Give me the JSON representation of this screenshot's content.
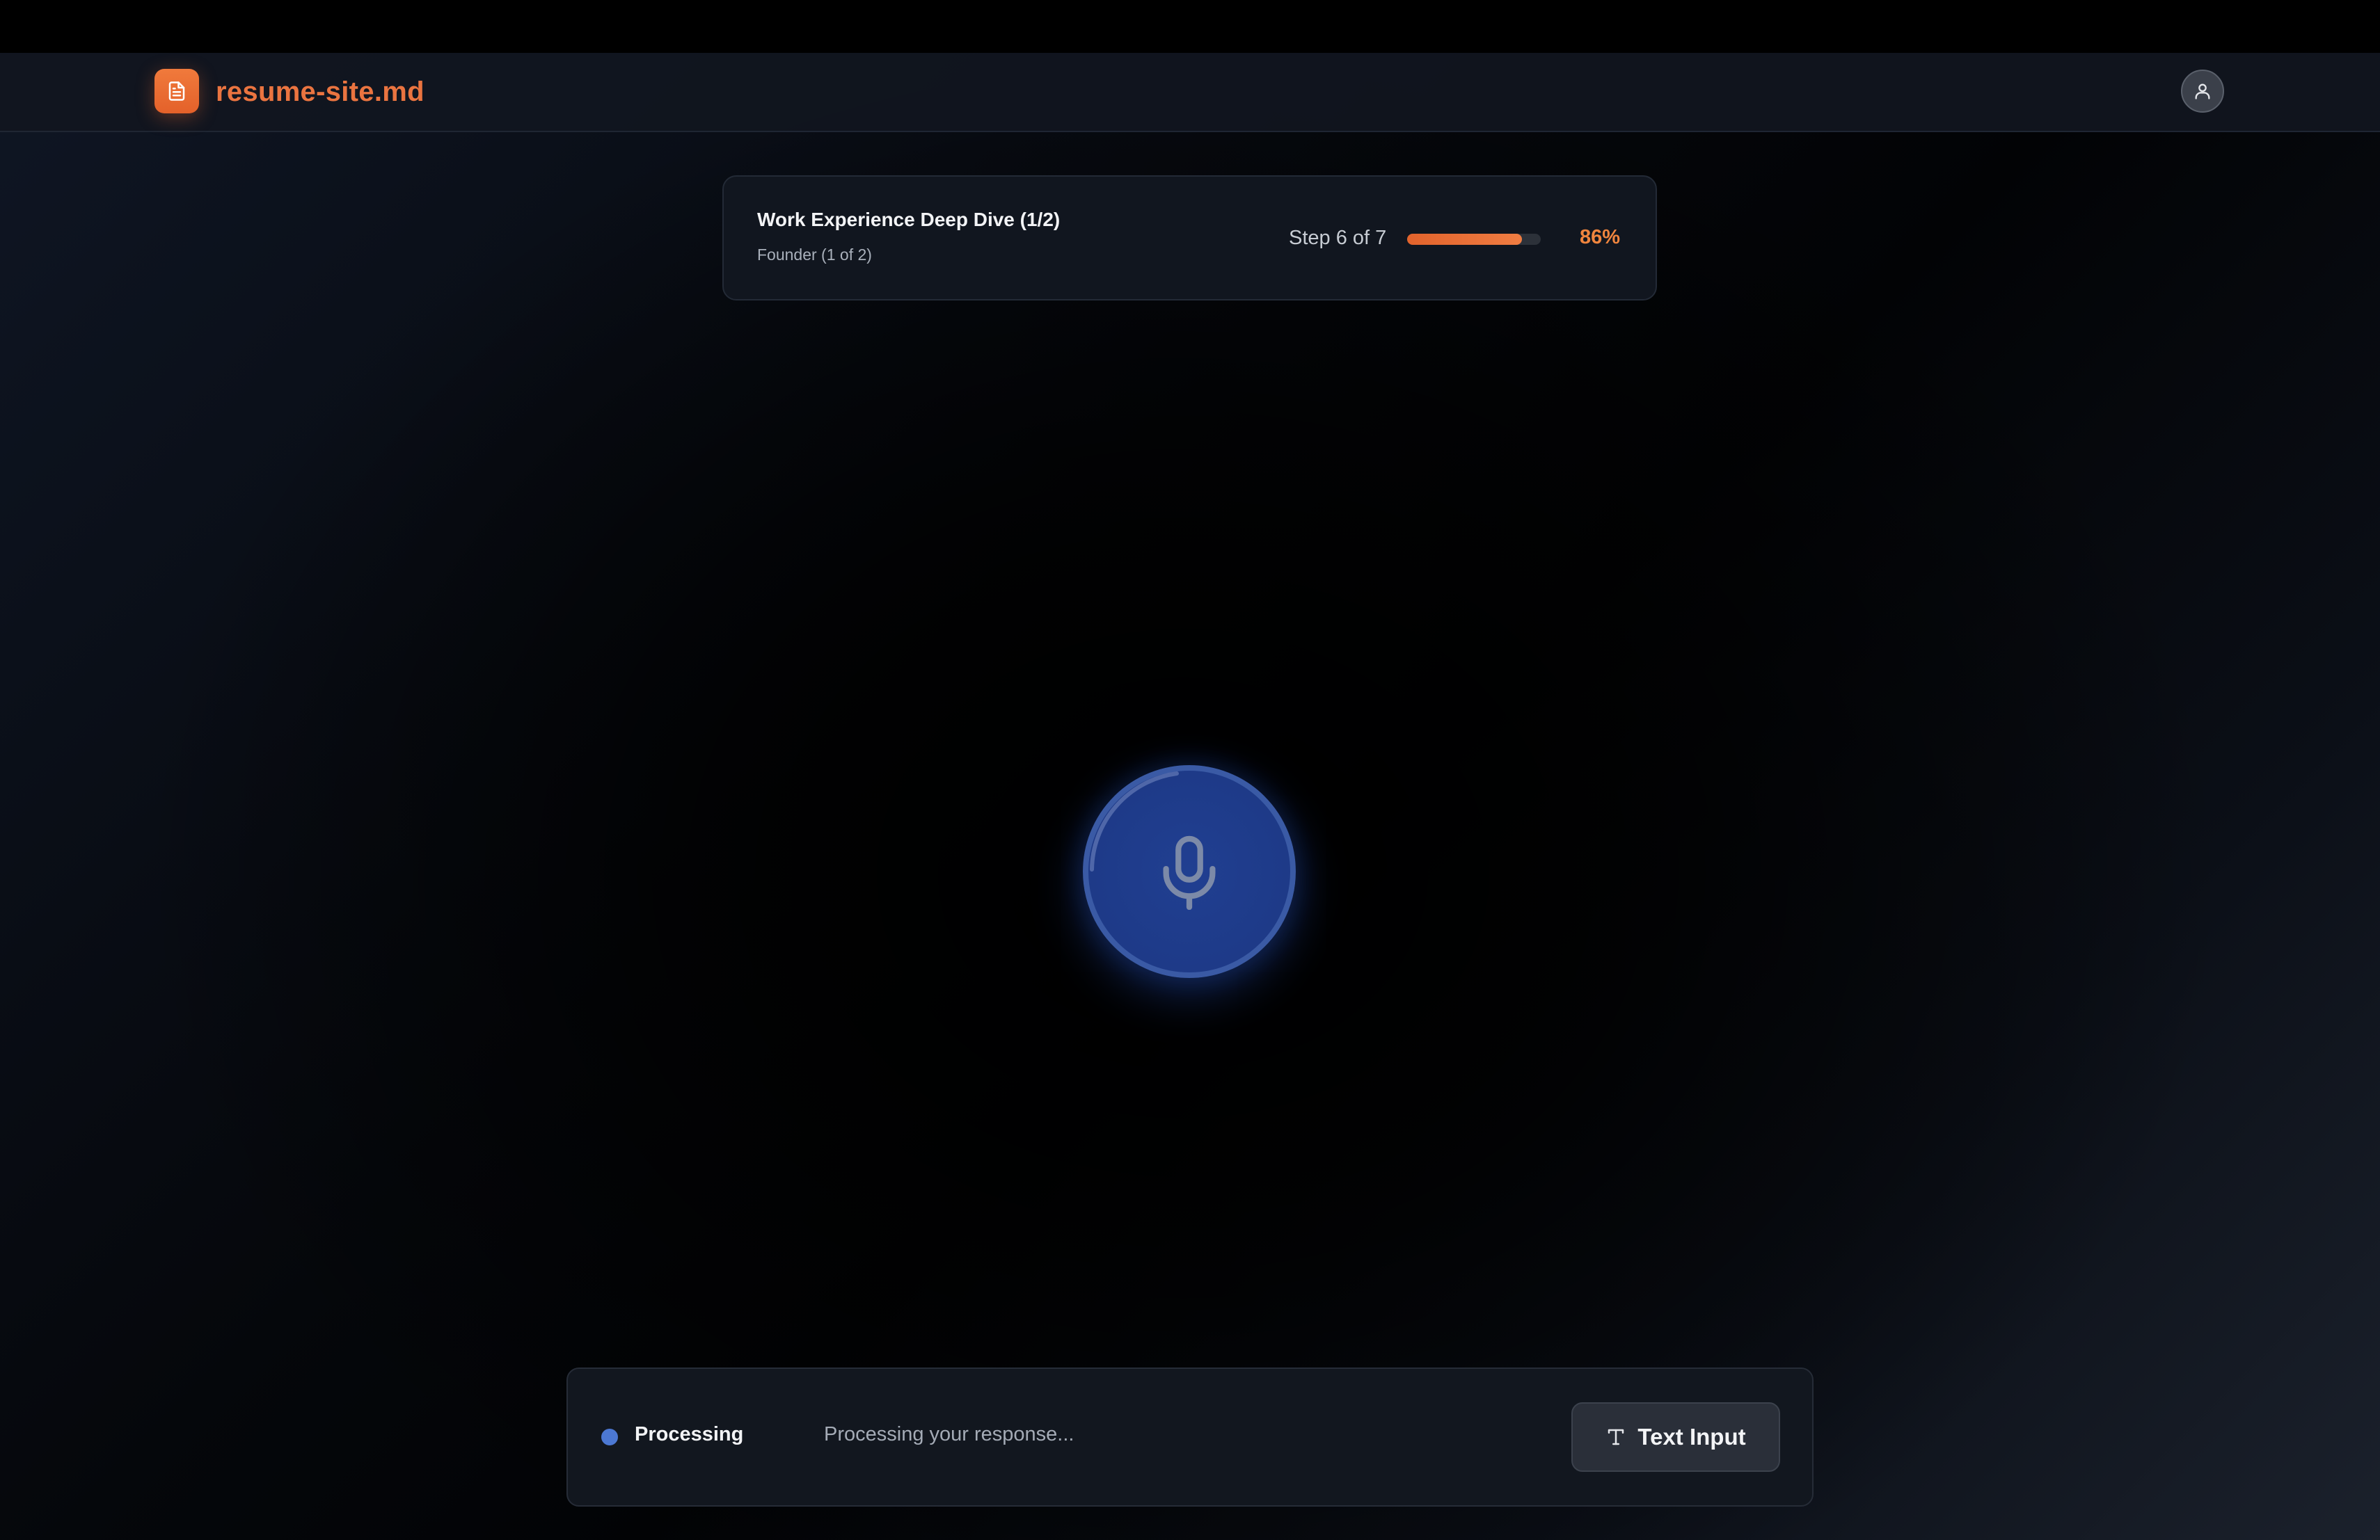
{
  "header": {
    "logo_text": "resume-site.md",
    "logo_icon": "document-icon",
    "avatar_icon": "user-icon"
  },
  "progress": {
    "title": "Work Experience Deep Dive (1/2)",
    "subtitle": "Founder (1 of 2)",
    "step_label": "Step 6 of 7",
    "percent_label": "86%",
    "fraction": 0.86
  },
  "mic": {
    "icon": "microphone-icon",
    "state": "processing"
  },
  "status": {
    "label": "Processing",
    "message": "Processing your response...",
    "text_input_label": "Text Input",
    "text_input_icon": "type-icon"
  },
  "colors": {
    "accent": "#ea7440",
    "processing": "#4c78d3",
    "mic_fill": "#1e3a88"
  }
}
